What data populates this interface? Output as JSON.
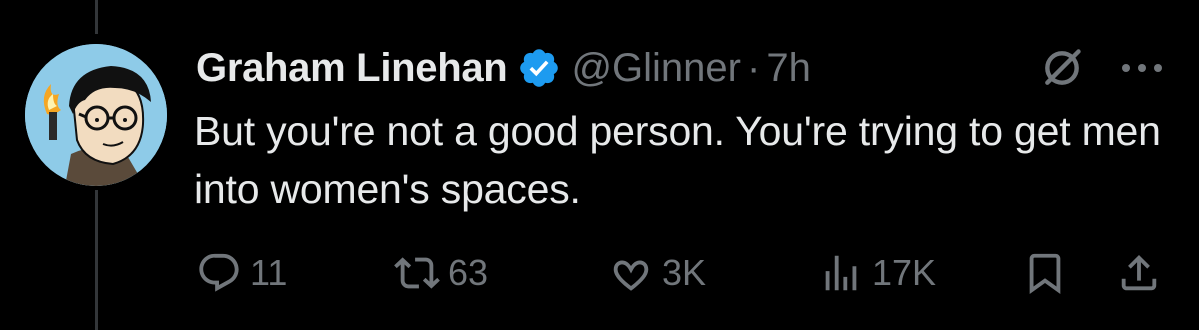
{
  "tweet": {
    "author_name": "Graham Linehan",
    "handle": "@Glinner",
    "separator": "·",
    "time": "7h",
    "text": "But you're not a good person. You're trying to get men into women's spaces."
  },
  "actions": {
    "replies": "11",
    "reposts": "63",
    "likes": "3K",
    "views": "17K"
  },
  "icons": {
    "verified": "verified-badge-icon",
    "grok": "grok-icon",
    "more": "more-icon",
    "reply": "reply-icon",
    "repost": "repost-icon",
    "like": "like-icon",
    "views": "views-icon",
    "bookmark": "bookmark-icon",
    "share": "share-icon"
  },
  "colors": {
    "background": "#000000",
    "text": "#e7e9ea",
    "muted": "#71767b",
    "verified": "#1d9bf0",
    "thread_line": "#333639"
  }
}
